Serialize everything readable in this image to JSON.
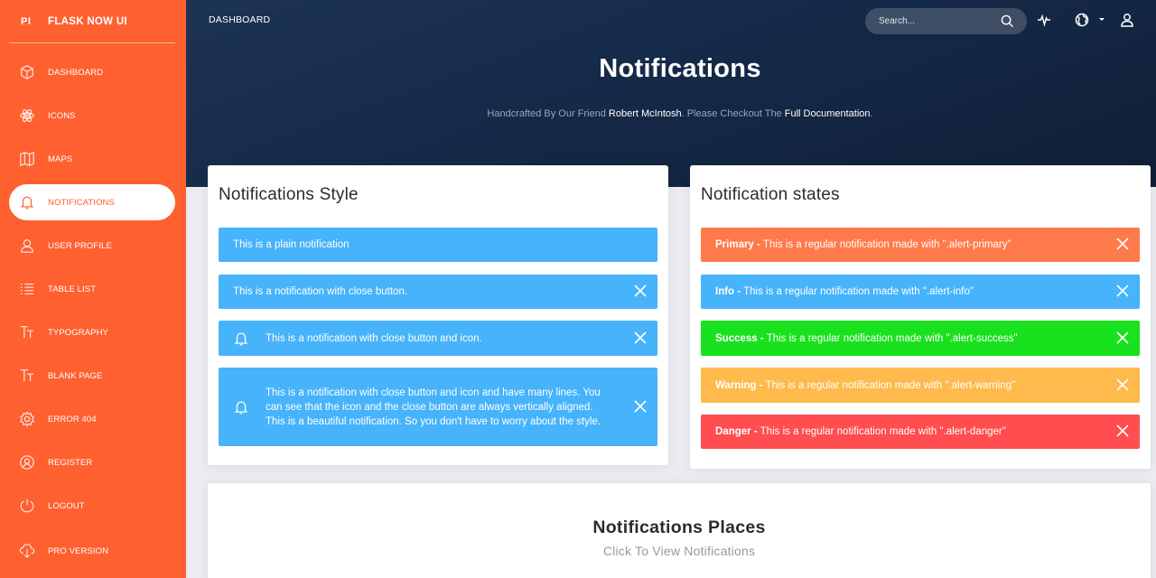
{
  "sidebar": {
    "brand_mini": "PI",
    "brand_name": "FLASK NOW UI",
    "items": [
      {
        "label": "DASHBOARD",
        "icon": "cube-icon"
      },
      {
        "label": "ICONS",
        "icon": "atom-icon"
      },
      {
        "label": "MAPS",
        "icon": "map-icon"
      },
      {
        "label": "NOTIFICATIONS",
        "icon": "bell-icon",
        "active": true
      },
      {
        "label": "USER PROFILE",
        "icon": "user-icon"
      },
      {
        "label": "TABLE LIST",
        "icon": "list-icon"
      },
      {
        "label": "TYPOGRAPHY",
        "icon": "text-icon"
      },
      {
        "label": "BLANK PAGE",
        "icon": "text-icon"
      },
      {
        "label": "ERROR 404",
        "icon": "gear-icon"
      },
      {
        "label": "REGISTER",
        "icon": "register-icon"
      },
      {
        "label": "LOGOUT",
        "icon": "power-icon"
      },
      {
        "label": "PRO VERSION",
        "icon": "cloud-download-icon"
      }
    ]
  },
  "topbar": {
    "title": "DASHBOARD",
    "search_placeholder": "Search..."
  },
  "header": {
    "title": "Notifications",
    "subtitle_prefix": "Handcrafted By Our Friend ",
    "subtitle_author": "Robert McIntosh",
    "subtitle_middle": ". Please Checkout The ",
    "subtitle_link": "Full Documentation",
    "subtitle_suffix": "."
  },
  "styles_card": {
    "title": "Notifications Style",
    "alerts": [
      {
        "text": "This is a plain notification"
      },
      {
        "text": "This is a notification with close button."
      },
      {
        "text": "This is a notification with close button and icon."
      },
      {
        "text": "This is a notification with close button and icon and have many lines. You can see that the icon and the close button are always vertically aligned. This is a beautiful notification. So you don't have to worry about the style."
      }
    ]
  },
  "states_card": {
    "title": "Notification states",
    "alerts": [
      {
        "strong": "Primary -",
        "text": " This is a regular notification made with \".alert-primary\""
      },
      {
        "strong": "Info -",
        "text": " This is a regular notification made with \".alert-info\""
      },
      {
        "strong": "Success -",
        "text": " This is a regular notification made with \".alert-success\""
      },
      {
        "strong": "Warning -",
        "text": " This is a regular notification made with \".alert-warning\""
      },
      {
        "strong": "Danger -",
        "text": " This is a regular notification made with \".alert-danger\""
      }
    ]
  },
  "places_card": {
    "title": "Notifications Places",
    "subtitle": "Click To View Notifications"
  },
  "colors": {
    "sidebar": "#ff6030",
    "header": "#152a48",
    "info": "#47b3fb",
    "primary": "#ff7a4a",
    "success": "#19e11e",
    "warning": "#ffba4d",
    "danger": "#ff4d50"
  }
}
